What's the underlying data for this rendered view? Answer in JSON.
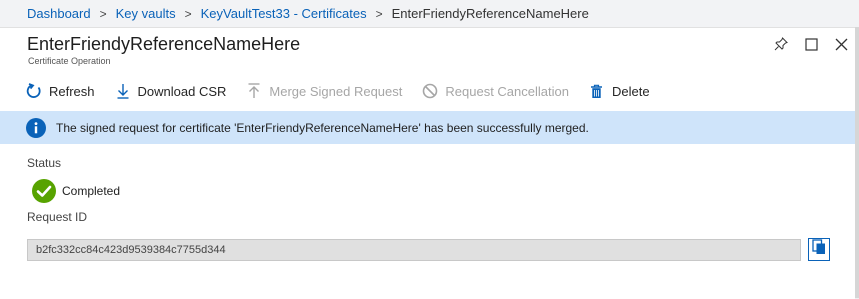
{
  "breadcrumb": {
    "items": [
      "Dashboard",
      "Key vaults",
      "KeyVaultTest33 - Certificates"
    ],
    "current": "EnterFriendyReferenceNameHere",
    "separator": ">"
  },
  "blade": {
    "title": "EnterFriendyReferenceNameHere",
    "subtitle": "Certificate Operation"
  },
  "toolbar": {
    "refresh": "Refresh",
    "download_csr": "Download CSR",
    "merge": "Merge Signed Request",
    "request_cancel": "Request Cancellation",
    "delete": "Delete"
  },
  "banner": {
    "message": "The signed request for certificate 'EnterFriendyReferenceNameHere' has been successfully merged."
  },
  "status": {
    "label": "Status",
    "value": "Completed"
  },
  "request_id": {
    "label": "Request ID",
    "value": "b2fc332cc84c423d9539384c7755d344"
  },
  "colors": {
    "accent": "#0a62b8",
    "banner_bg": "#cfe4fa",
    "success": "#57a300",
    "disabled": "#a6a6a6"
  },
  "icons": {
    "refresh": "refresh-icon",
    "download": "download-icon",
    "merge": "upload-arrow-icon",
    "cancel": "cancel-icon",
    "delete": "trash-icon",
    "info": "info-icon",
    "success": "checkmark-circle-icon",
    "copy": "copy-icon",
    "pin": "pin-icon",
    "maximize": "maximize-icon",
    "close": "close-icon"
  }
}
